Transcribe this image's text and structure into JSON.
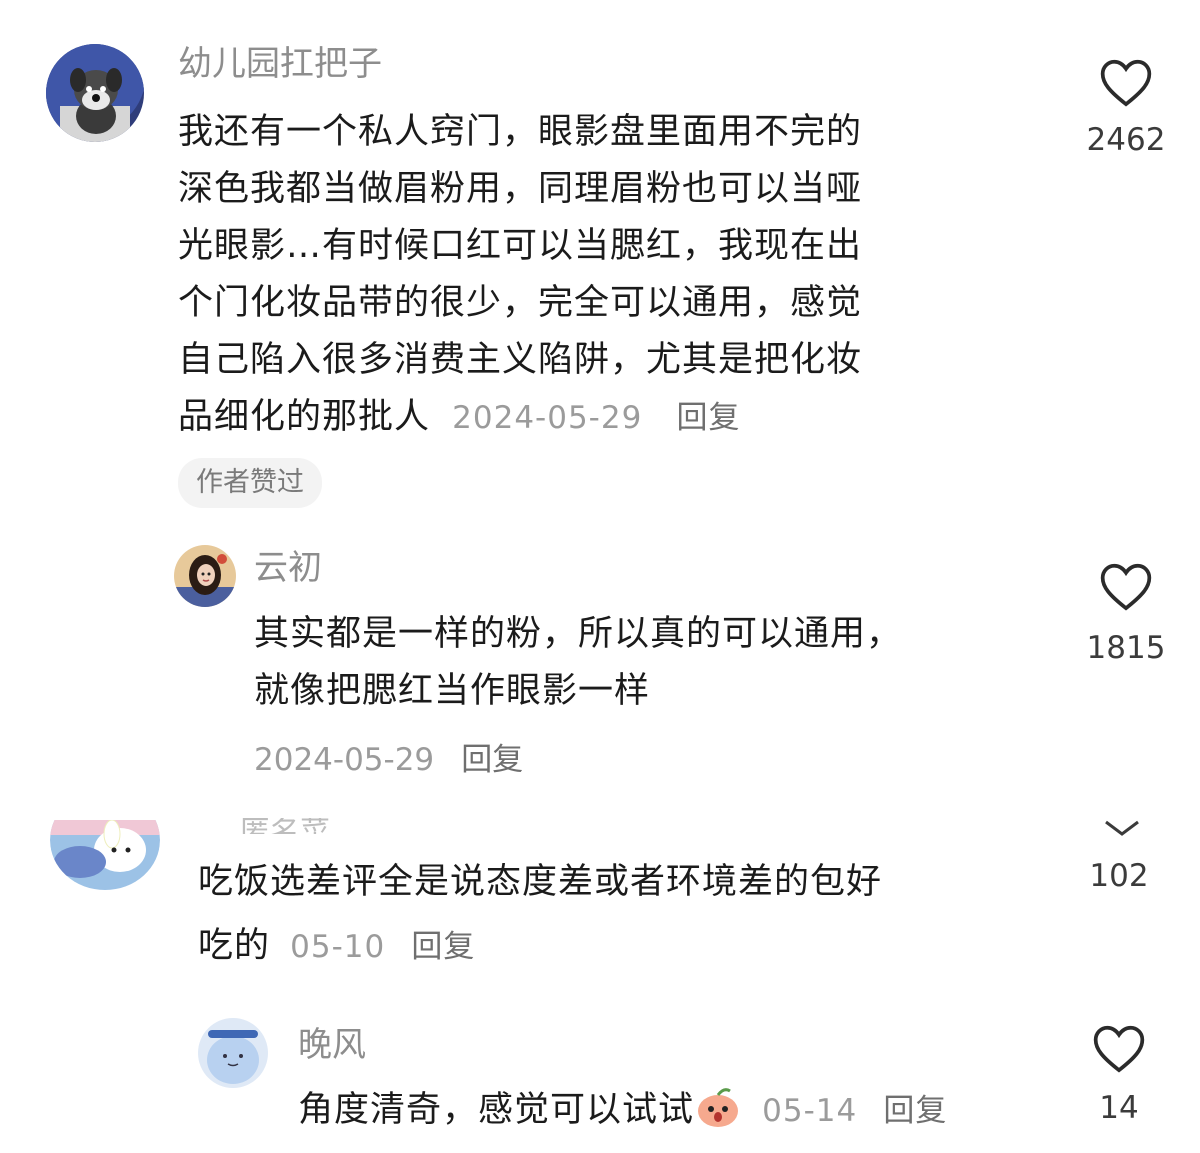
{
  "comments": [
    {
      "username": "幼儿园扛把子",
      "text_lines": [
        "我还有一个私人窍门，眼影盘里面用不完的",
        "深色我都当做眉粉用，同理眉粉也可以当哑",
        "光眼影…有时候口红可以当腮红，我现在出",
        "个门化妆品带的很少，完全可以通用，感觉",
        "自己陷入很多消费主义陷阱，尤其是把化妆",
        "品细化的那批人"
      ],
      "date": "2024-05-29",
      "reply_label": "回复",
      "badge": "作者赞过",
      "likes": "2462",
      "avatar_icon": "schnauzer-plush-avatar"
    },
    {
      "username": "云初",
      "text_lines": [
        "其实都是一样的粉，所以真的可以通用，",
        "就像把腮红当作眼影一样"
      ],
      "date": "2024-05-29",
      "reply_label": "回复",
      "likes": "1815",
      "avatar_icon": "illustrated-girl-avatar"
    },
    {
      "username": "匿名菜",
      "text_lines": [
        "吃饭选差评全是说态度差或者环境差的包好",
        "吃的"
      ],
      "date": "05-10",
      "reply_label": "回复",
      "likes": "102",
      "avatar_icon": "cartoon-bunny-avatar"
    },
    {
      "username": "晚风",
      "text_lines": [
        "角度清奇，感觉可以试试"
      ],
      "date": "05-14",
      "reply_label": "回复",
      "likes": "14",
      "avatar_icon": "blue-blob-avatar",
      "emoji_icon": "surprised-peach-emoji"
    }
  ],
  "colors": {
    "username": "#8d8d8d",
    "text": "#1b1b1b",
    "meta": "#9b9b9b",
    "badge_bg": "#f3f3f3"
  }
}
